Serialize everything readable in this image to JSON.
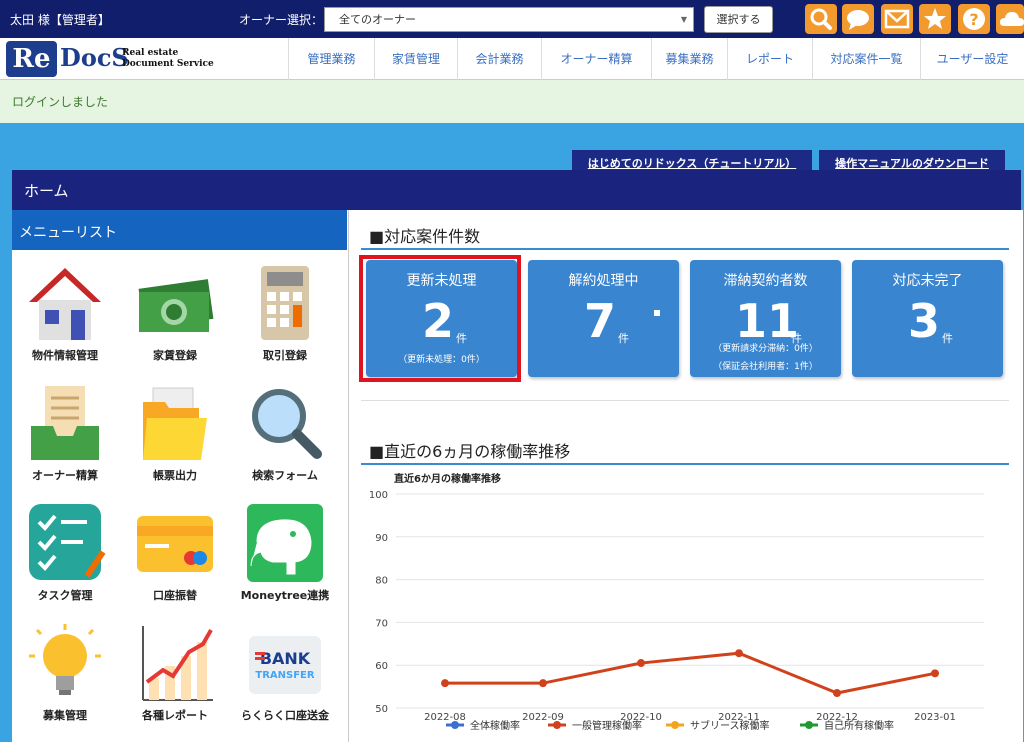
{
  "header": {
    "username": "太田 様【管理者】",
    "owner_label": "オーナー選択：",
    "owner_value": "全てのオーナー",
    "select_button": "選択する"
  },
  "logo": {
    "re": "Re",
    "docs": "DocS",
    "sub1": "Real estate",
    "sub2": "Document Service"
  },
  "nav": [
    "管理業務",
    "家賃管理",
    "会計業務",
    "オーナー精算",
    "募集業務",
    "レポート",
    "対応案件一覧",
    "ユーザー設定"
  ],
  "login_message": "ログインしました",
  "tutorial_buttons": [
    "はじめてのリドックス（チュートリアル）",
    "操作マニュアルのダウンロード"
  ],
  "home_title": "ホーム",
  "menu_title": "メニューリスト",
  "menu": [
    "物件情報管理",
    "家賃登録",
    "取引登録",
    "オーナー精算",
    "帳票出力",
    "検索フォーム",
    "タスク管理",
    "口座振替",
    "Moneytree連携",
    "募集管理",
    "各種レポート",
    "らくらく口座送金"
  ],
  "bank_logo": {
    "line1": "BANK",
    "line2": "TRANSFER"
  },
  "case_section": "■対応案件件数",
  "cards": [
    {
      "title": "更新未処理",
      "count": "2",
      "unit": "件",
      "sub1": "（更新未処理：0件）",
      "sub2": ""
    },
    {
      "title": "解約処理中",
      "count": "7",
      "unit": "件",
      "sub1": "",
      "sub2": ""
    },
    {
      "title": "滞納契約者数",
      "count": "11",
      "unit": "件",
      "sub1": "（更新請求分滞納：0件）",
      "sub2": "（保証会社利用者：1件）"
    },
    {
      "title": "対応未完了",
      "count": "3",
      "unit": "件",
      "sub1": "",
      "sub2": ""
    }
  ],
  "chart_section": "■直近の6ヵ月の稼働率推移",
  "chart_data": {
    "type": "line",
    "title": "直近6か月の稼働率推移",
    "categories": [
      "2022-08",
      "2022-09",
      "2022-10",
      "2022-11",
      "2022-12",
      "2023-01"
    ],
    "ylim": [
      50,
      100
    ],
    "yticks": [
      50,
      60,
      70,
      80,
      90,
      100
    ],
    "grid": true,
    "legend_position": "bottom",
    "legend": [
      {
        "name": "全体稼働率",
        "color": "#3c6fd1"
      },
      {
        "name": "一般管理稼働率",
        "color": "#d0421c"
      },
      {
        "name": "サブリース稼働率",
        "color": "#f5a41d"
      },
      {
        "name": "自己所有稼働率",
        "color": "#1f9a2e"
      }
    ],
    "series": [
      {
        "name": "一般管理稼働率",
        "color": "#d0421c",
        "values": [
          55.8,
          55.8,
          60.5,
          62.8,
          53.5,
          58.1
        ]
      }
    ]
  }
}
